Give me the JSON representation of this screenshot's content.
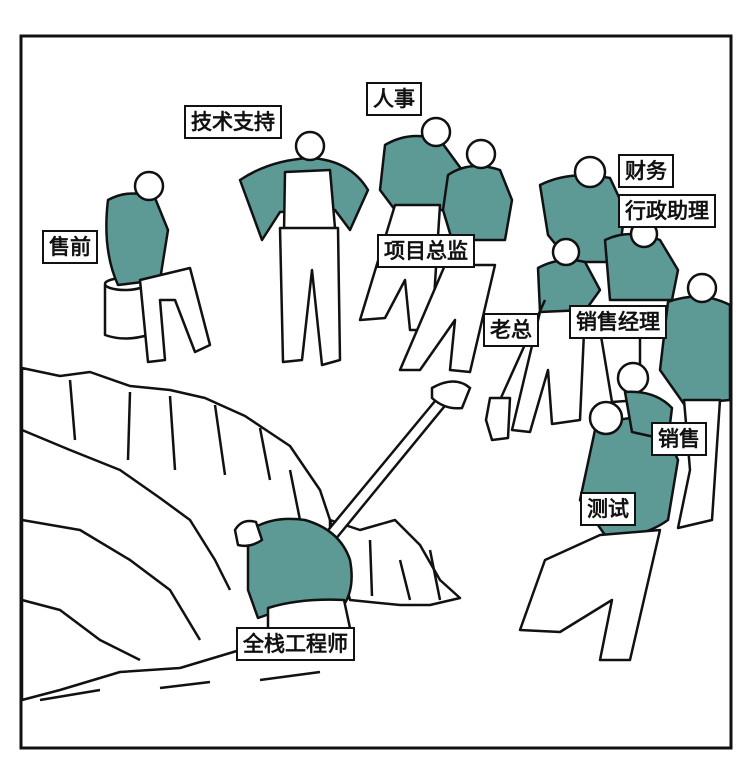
{
  "colors": {
    "shirt": "#5e9a95",
    "ink": "#111111",
    "background": "#ffffff"
  },
  "labels": {
    "presales": "售前",
    "tech_support": "技术支持",
    "hr": "人事",
    "project_director": "项目总监",
    "finance": "财务",
    "admin_assistant": "行政助理",
    "boss": "老总",
    "sales_manager": "销售经理",
    "sales": "销售",
    "qa": "测试",
    "fullstack": "全栈工程师"
  }
}
